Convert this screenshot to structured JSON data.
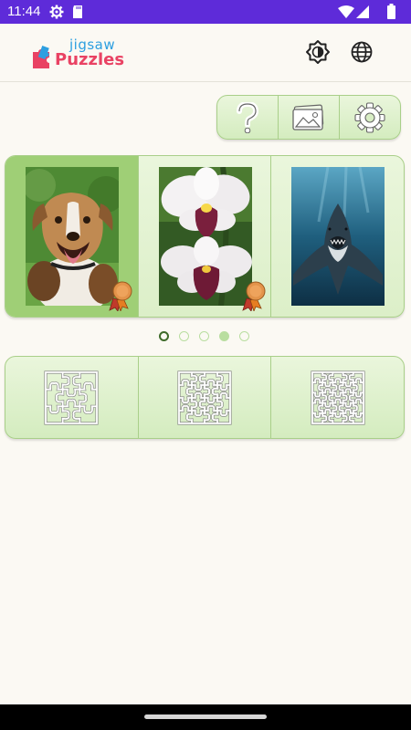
{
  "status_bar": {
    "time": "11:44",
    "left_icons": [
      "settings-gear-icon",
      "sd-card-icon"
    ],
    "right_icons": [
      "wifi-icon",
      "signal-icon",
      "battery-icon"
    ],
    "background": "#5e2bd9"
  },
  "app_bar": {
    "logo_top": "jigsaw",
    "logo_bottom": "Puzzles",
    "actions": [
      "theme-toggle-icon",
      "language-globe-icon"
    ]
  },
  "toolbar": {
    "buttons": [
      "help-question-icon",
      "gallery-image-icon",
      "settings-gear-icon"
    ]
  },
  "carousel": {
    "slides": [
      {
        "subject": "dog",
        "selected": true,
        "medal": true
      },
      {
        "subject": "orchid",
        "selected": false,
        "medal": true
      },
      {
        "subject": "shark",
        "selected": false,
        "medal": false
      }
    ],
    "page_count": 5,
    "current_page": 1,
    "highlighted_page": 4
  },
  "difficulty": {
    "options": [
      "easy-puzzle-icon",
      "medium-puzzle-icon",
      "hard-puzzle-icon"
    ]
  },
  "colors": {
    "accent_green": "#a9cf89",
    "selected_green": "#9fcf76",
    "page_background": "#fbf9f3"
  }
}
